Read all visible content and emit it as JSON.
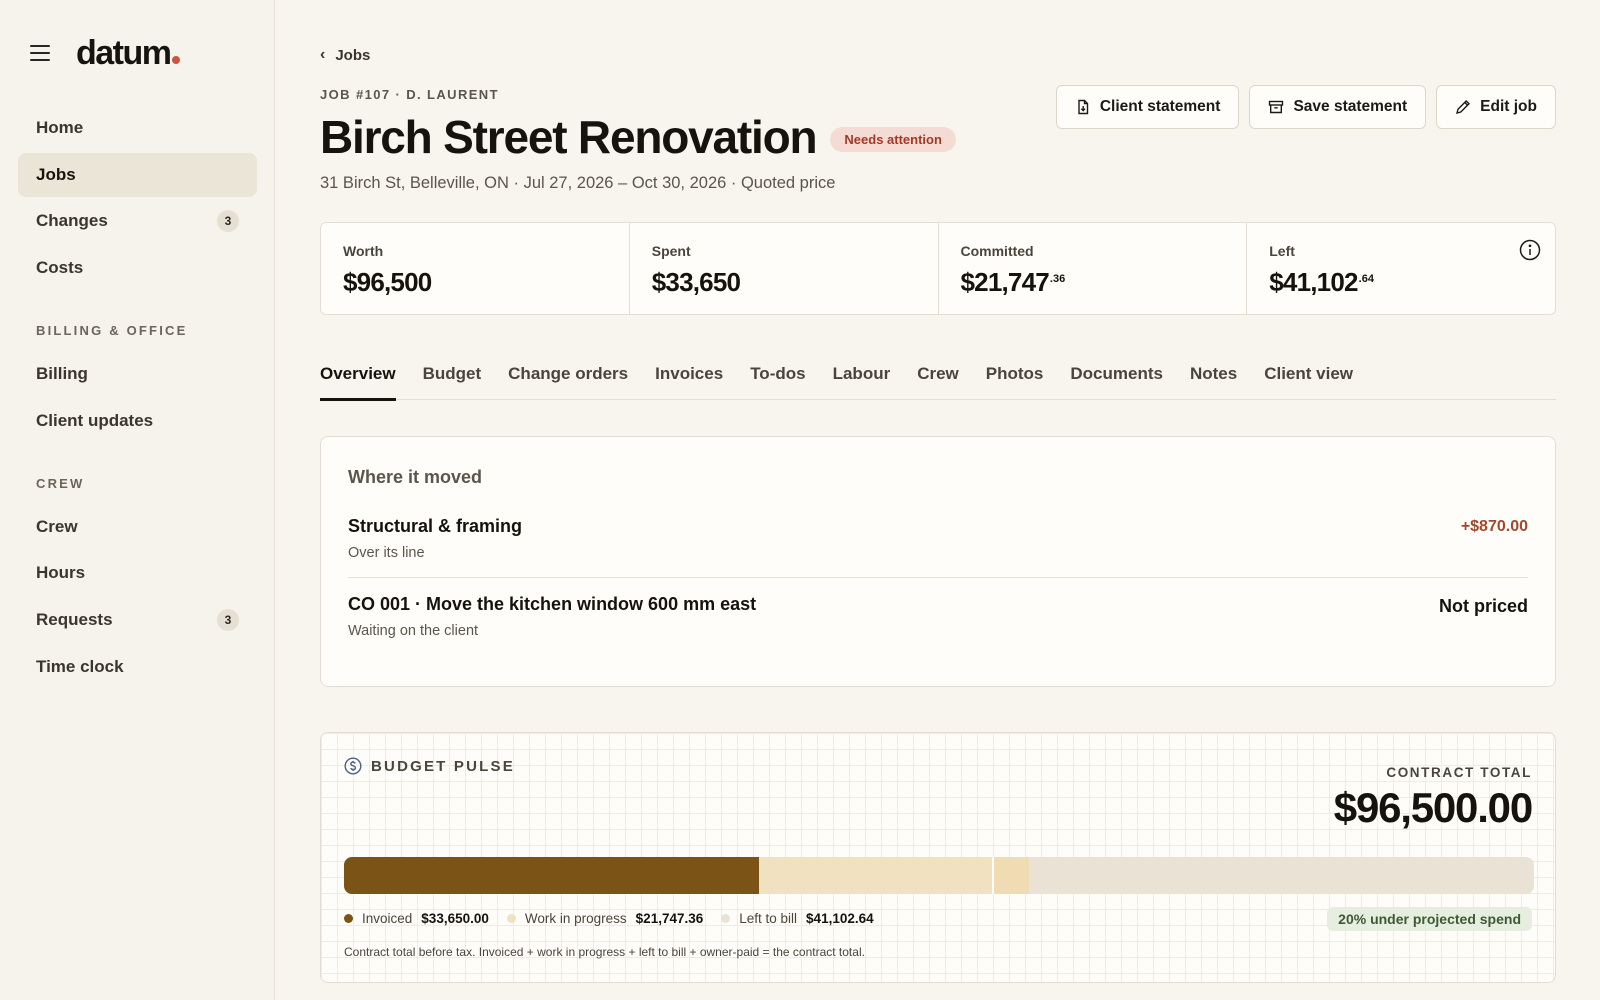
{
  "app": {
    "logo": "datum"
  },
  "sidebar": {
    "items": [
      {
        "label": "Home"
      },
      {
        "label": "Jobs",
        "active": true
      },
      {
        "label": "Changes",
        "badge": "3"
      },
      {
        "label": "Costs"
      }
    ],
    "sections": [
      {
        "title": "BILLING & OFFICE",
        "items": [
          {
            "label": "Billing"
          },
          {
            "label": "Client updates"
          }
        ]
      },
      {
        "title": "CREW",
        "items": [
          {
            "label": "Crew"
          },
          {
            "label": "Hours"
          },
          {
            "label": "Requests",
            "badge": "3"
          },
          {
            "label": "Time clock"
          }
        ]
      }
    ]
  },
  "header": {
    "breadcrumb": "Jobs",
    "job_meta": "JOB #107 · D. LAURENT",
    "title": "Birch Street Renovation",
    "status": "Needs attention",
    "subline": "31 Birch St, Belleville, ON · Jul 27, 2026 – Oct 30, 2026 · Quoted price",
    "actions": {
      "client_statement": "Client statement",
      "save_statement": "Save statement",
      "edit_job": "Edit job"
    }
  },
  "stats": [
    {
      "label": "Worth",
      "value": "$96,500",
      "cents": ""
    },
    {
      "label": "Spent",
      "value": "$33,650",
      "cents": ""
    },
    {
      "label": "Committed",
      "value": "$21,747",
      "cents": ".36"
    },
    {
      "label": "Left",
      "value": "$41,102",
      "cents": ".64"
    }
  ],
  "tabs": [
    {
      "label": "Overview",
      "active": true
    },
    {
      "label": "Budget"
    },
    {
      "label": "Change orders"
    },
    {
      "label": "Invoices"
    },
    {
      "label": "To-dos"
    },
    {
      "label": "Labour"
    },
    {
      "label": "Crew"
    },
    {
      "label": "Photos"
    },
    {
      "label": "Documents"
    },
    {
      "label": "Notes"
    },
    {
      "label": "Client view"
    }
  ],
  "moved": {
    "title": "Where it moved",
    "rows": [
      {
        "title": "Structural & framing",
        "sub": "Over its line",
        "amount": "+$870.00"
      },
      {
        "title": "CO 001 · Move the kitchen window 600 mm east",
        "sub": "Waiting on the client",
        "amount": "Not priced"
      }
    ]
  },
  "budget_pulse": {
    "title": "BUDGET PULSE",
    "contract_label": "CONTRACT TOTAL",
    "contract_value": "$96,500.00",
    "bar": {
      "invoiced": 33650.0,
      "wip": 21747.36,
      "left": 41102.64,
      "total": 96500.0
    },
    "legend": [
      {
        "label": "Invoiced",
        "value": "$33,650.00",
        "color": "#7c5316"
      },
      {
        "label": "Work in progress",
        "value": "$21,747.36",
        "color": "#f0e2c0"
      },
      {
        "label": "Left to bill",
        "value": "$41,102.64",
        "color": "#e9e2d5"
      }
    ],
    "badge": "20% under projected spend",
    "footnote": "Contract total before tax. Invoiced + work in progress + left to bill + owner-paid = the contract total."
  },
  "colors": {
    "accent": "#c8553d",
    "invoiced": "#7c5316",
    "wip": "#f0e2c0",
    "left": "#e9e2d5",
    "status_red": "#a03a26",
    "positive_green": "#3d5a34"
  }
}
